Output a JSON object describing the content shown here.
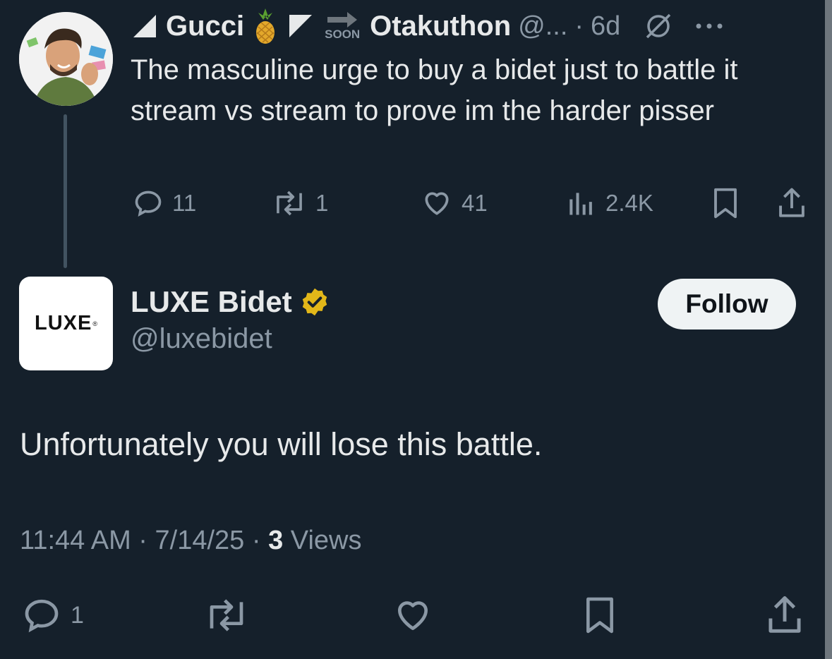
{
  "parent_tweet": {
    "display_name_part1": "Gucci",
    "soon_label": "SOON",
    "display_name_part2": "Otakuthon",
    "handle": "@...",
    "separator": "·",
    "time": "6d",
    "text": "The masculine urge to buy a bidet just to battle it stream vs stream to prove im the harder pisser",
    "counts": {
      "replies": "11",
      "reposts": "1",
      "likes": "41",
      "views": "2.4K"
    }
  },
  "reply_tweet": {
    "avatar_logo_text": "LUXE",
    "avatar_logo_mark": "®",
    "display_name": "LUXE Bidet",
    "handle": "@luxebidet",
    "follow_label": "Follow",
    "text": "Unfortunately you will lose this battle.",
    "meta": {
      "time": "11:44 AM",
      "sep1": " · ",
      "date": "7/14/25",
      "sep2": " · ",
      "views_count": "3",
      "views_label": " Views"
    },
    "counts": {
      "replies": "1"
    }
  },
  "colors": {
    "background": "#15202b",
    "text_primary": "#e7e9ea",
    "text_secondary": "#8b98a5",
    "verified_gold": "#e2b719"
  }
}
